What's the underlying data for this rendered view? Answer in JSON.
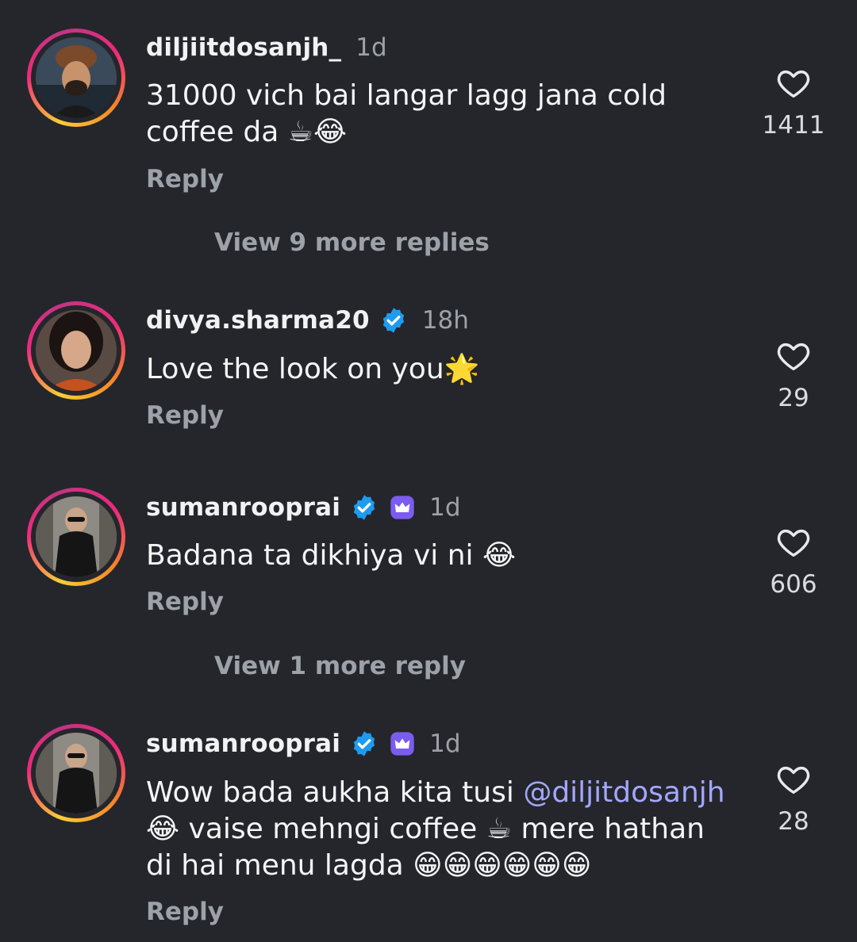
{
  "comments": [
    {
      "username": "diljiitdosanjh_",
      "time": "1d",
      "text": "31000 vich bai langar lagg jana cold coffee da ☕😂",
      "reply_label": "Reply",
      "likes": "1411",
      "view_replies": "View 9 more replies"
    },
    {
      "username": "divya.sharma20",
      "time": "18h",
      "text": "Love the look on you🌟",
      "reply_label": "Reply",
      "likes": "29"
    },
    {
      "username": "sumanrooprai",
      "time": "1d",
      "text": "Badana ta dikhiya vi ni 😂",
      "reply_label": "Reply",
      "likes": "606",
      "view_replies": "View 1 more reply"
    },
    {
      "username": "sumanrooprai",
      "time": "1d",
      "text_before": "Wow bada aukha kita tusi ",
      "mention": "@diljitdosanjh",
      "text_after": " 😂 vaise mehngi coffee ☕ mere hathan di hai menu lagda 😁😁😁😁😁😁",
      "reply_label": "Reply",
      "likes": "28"
    }
  ],
  "colors": {
    "background": "#24262b",
    "verified": "#1d9bf0",
    "crown_badge": "#7b5cf0",
    "mention": "#a3a7ff",
    "secondary_text": "#9da1a8"
  },
  "icons": {
    "like": "heart-outline-icon",
    "verified": "verified-badge-icon",
    "subscriber": "crown-badge-icon"
  }
}
